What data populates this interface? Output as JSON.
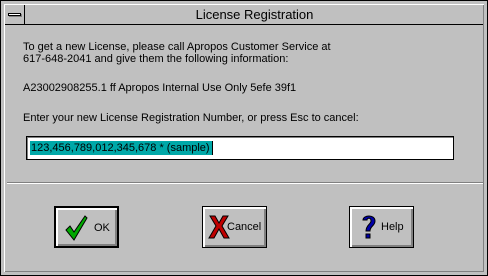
{
  "window": {
    "title": "License Registration"
  },
  "message": {
    "line1": "To get a new License, please call Apropos Customer Service at",
    "line2": "617-648-2041  and give them the following information:",
    "info": "A23002908255.1 ff Apropos Internal Use Only 5efe 39f1",
    "prompt": "Enter your new License Registration Number, or press Esc to cancel:"
  },
  "input": {
    "value": "123,456,789,012,345,678 * (sample)"
  },
  "buttons": {
    "ok_label": "OK",
    "cancel_label": "Cancel",
    "help_label": "Help"
  },
  "colors": {
    "selection": "#00a8a8",
    "ok_check": "#00a800",
    "cancel_x": "#c00000",
    "help_mark": "#0000a8"
  }
}
